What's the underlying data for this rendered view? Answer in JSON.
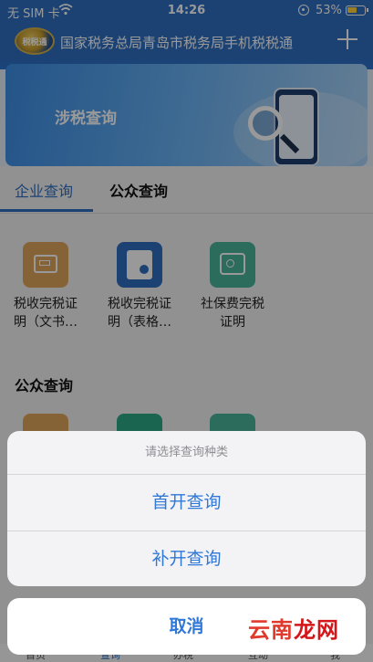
{
  "status_bar": {
    "carrier": "无 SIM 卡",
    "time": "14:26",
    "battery": "53%"
  },
  "header": {
    "title": "国家税务总局青岛市税务局手机税税通",
    "logo_text": "税税通"
  },
  "banner": {
    "title": "涉税查询"
  },
  "tabs": [
    {
      "label": "企业查询",
      "active": true
    },
    {
      "label": "公众查询",
      "active": false
    }
  ],
  "enterprise_items": [
    {
      "label_line1": "税收完税证",
      "label_line2": "明（文书…",
      "icon": "certificate-card-icon"
    },
    {
      "label_line1": "税收完税证",
      "label_line2": "明（表格…",
      "icon": "tax-document-icon"
    },
    {
      "label_line1": "社保费完税",
      "label_line2": "证明",
      "icon": "social-security-icon"
    }
  ],
  "public_section": {
    "title": "公众查询"
  },
  "action_sheet": {
    "title": "请选择查询种类",
    "options": [
      "首开查询",
      "补开查询"
    ],
    "cancel": "取消"
  },
  "tabbar": {
    "items": [
      "首页",
      "查询",
      "办税",
      "互动",
      "我"
    ]
  },
  "watermark": {
    "text_part1": "云南",
    "text_part2": "龙网"
  },
  "colors": {
    "brand_blue": "#2f6fc1",
    "sheet_text": "#2f78d6"
  }
}
